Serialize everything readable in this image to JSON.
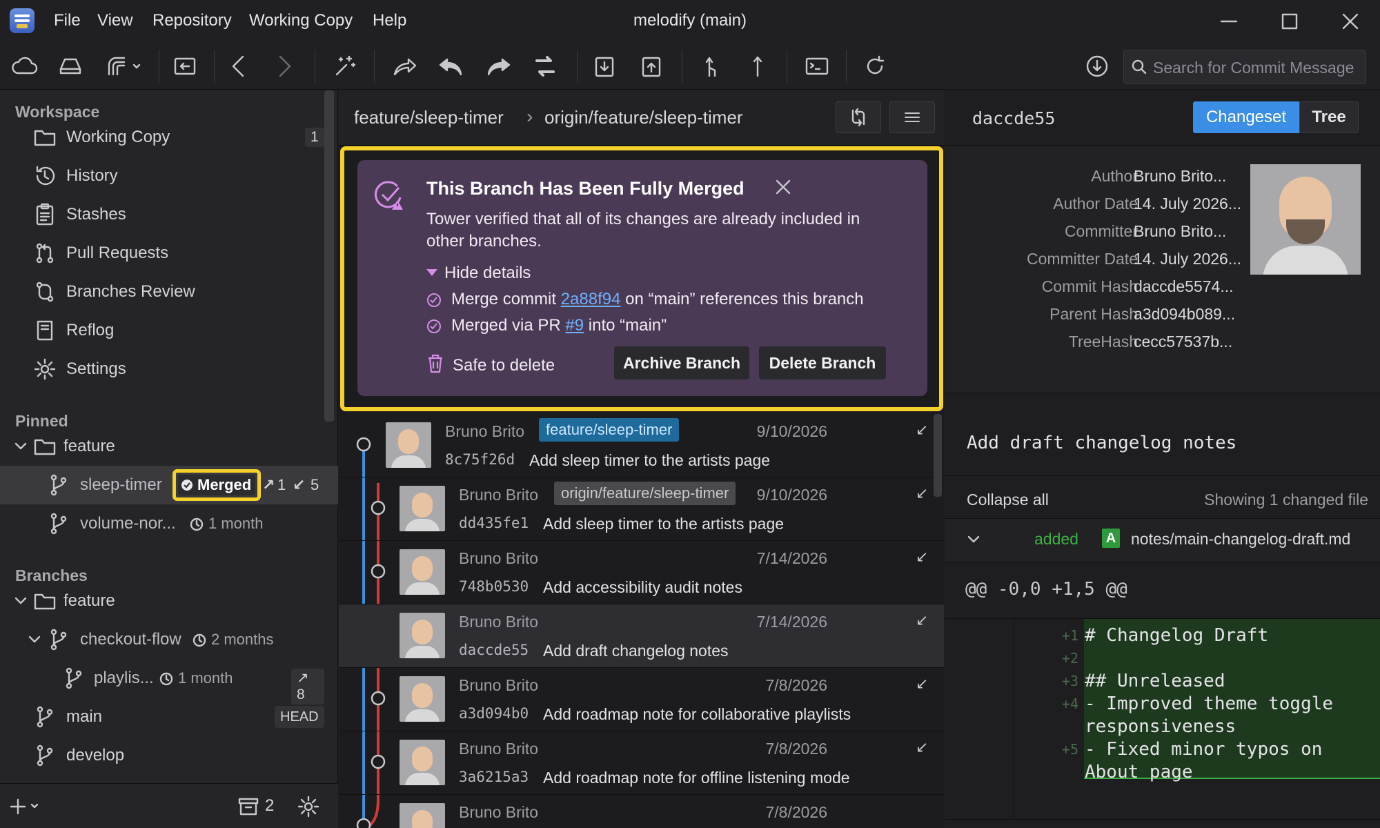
{
  "menu": {
    "file": "File",
    "view": "View",
    "repository": "Repository",
    "working_copy": "Working Copy",
    "help": "Help"
  },
  "window": {
    "title": "melodify (main)"
  },
  "toolbar": {
    "search_placeholder": "Search for Commit Message"
  },
  "sidebar": {
    "workspace_header": "Workspace",
    "workspace_items": [
      {
        "label": "Working Copy",
        "count": "1"
      },
      {
        "label": "History"
      },
      {
        "label": "Stashes"
      },
      {
        "label": "Pull Requests"
      },
      {
        "label": "Branches Review"
      },
      {
        "label": "Reflog"
      },
      {
        "label": "Settings"
      }
    ],
    "pinned_header": "Pinned",
    "pinned_folder": "feature",
    "pinned_branches": [
      {
        "label": "sleep-timer",
        "badge": "Merged",
        "ahead": "1",
        "behind": "5"
      },
      {
        "label": "volume-nor...",
        "age": "1 month"
      }
    ],
    "branches_header": "Branches",
    "branches_folder": "feature",
    "branches": [
      {
        "label": "checkout-flow",
        "age": "2 months"
      },
      {
        "label": "playlis...",
        "age": "1 month",
        "ahead": "8"
      },
      {
        "label": "main",
        "badge": "HEAD"
      },
      {
        "label": "develop"
      }
    ],
    "stash_count": "2"
  },
  "middle": {
    "breadcrumb_local": "feature/sleep-timer",
    "breadcrumb_sep": "›",
    "breadcrumb_remote": "origin/feature/sleep-timer"
  },
  "banner": {
    "title": "This Branch Has Been Fully Merged",
    "text": "Tower verified that all of its changes are already included in other branches.",
    "toggle": "Hide details",
    "check1_pre": "Merge commit ",
    "check1_link": "2a88f94",
    "check1_post": " on “main” references this branch",
    "check2_pre": "Merged via PR ",
    "check2_link": "#9",
    "check2_post": " into “main”",
    "safe": "Safe to delete",
    "archive": "Archive Branch",
    "delete": "Delete Branch"
  },
  "commits": [
    {
      "author": "Bruno Brito",
      "tag": "feature/sleep-timer",
      "date": "9/10/2026",
      "hash": "8c75f26d",
      "msg": "Add sleep timer to the artists page"
    },
    {
      "author": "Bruno Brito",
      "tag": "origin/feature/sleep-timer",
      "date": "9/10/2026",
      "hash": "dd435fe1",
      "msg": "Add sleep timer to the artists page"
    },
    {
      "author": "Bruno Brito",
      "date": "7/14/2026",
      "hash": "748b0530",
      "msg": "Add accessibility audit notes"
    },
    {
      "author": "Bruno Brito",
      "date": "7/14/2026",
      "hash": "daccde55",
      "msg": "Add draft changelog notes"
    },
    {
      "author": "Bruno Brito",
      "date": "7/8/2026",
      "hash": "a3d094b0",
      "msg": "Add roadmap note for collaborative playlists"
    },
    {
      "author": "Bruno Brito",
      "date": "7/8/2026",
      "hash": "3a6215a3",
      "msg": "Add roadmap note for offline listening mode"
    },
    {
      "author": "Bruno Brito",
      "date": "7/8/2026"
    }
  ],
  "details": {
    "hash_title": "daccde55",
    "tab_changeset": "Changeset",
    "tab_tree": "Tree",
    "fields": [
      {
        "label": "Author",
        "value": "Bruno Brito..."
      },
      {
        "label": "Author Date",
        "value": "14. July 2026..."
      },
      {
        "label": "Committer",
        "value": "Bruno Brito..."
      },
      {
        "label": "Committer Date",
        "value": "14. July 2026..."
      },
      {
        "label": "Commit Hash",
        "value": "daccde5574..."
      },
      {
        "label": "Parent Hash",
        "value": "a3d094b089..."
      },
      {
        "label": "TreeHash",
        "value": "cecc57537b..."
      }
    ],
    "subject": "Add draft changelog notes",
    "collapse": "Collapse all",
    "showing": "Showing 1 changed file",
    "file_status": "added",
    "file_badge": "A",
    "file_path": "notes/main-changelog-draft.md",
    "hunk": "@@ -0,0 +1,5 @@",
    "lines": [
      {
        "num": "+1",
        "text": "# Changelog Draft"
      },
      {
        "num": "+2",
        "text": ""
      },
      {
        "num": "+3",
        "text": "## Unreleased"
      },
      {
        "num": "+4",
        "text": "- Improved theme toggle"
      },
      {
        "num": "",
        "text": "responsiveness"
      },
      {
        "num": "+5",
        "text": "- Fixed minor typos on"
      },
      {
        "num": "",
        "text": "About page"
      }
    ]
  },
  "colors": {
    "accent": "#3a8ee6",
    "highlight": "#f5d12c",
    "banner": "#4b3a55",
    "graph_blue": "#3c8fd6",
    "graph_red": "#d23a3a",
    "added": "#3cb043"
  }
}
